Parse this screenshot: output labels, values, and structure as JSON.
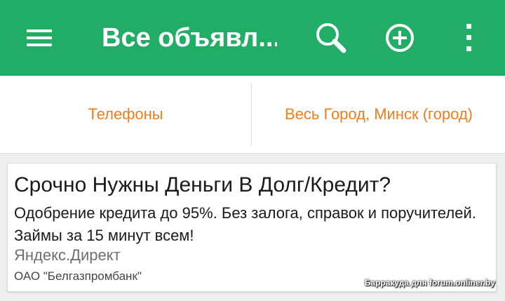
{
  "appbar": {
    "title": "Все объявл...",
    "menu_icon": "hamburger-menu-icon",
    "search_icon": "search-icon",
    "add_icon": "add-circle-icon",
    "more_icon": "more-vertical-icon",
    "background_color": "#22ad66"
  },
  "filters": {
    "category": "Телефоны",
    "location": "Весь Город, Минск (город)",
    "text_color": "#f07d1e"
  },
  "ad": {
    "title": "Срочно Нужны Деньги В Долг/Кредит?",
    "text": "Одобрение кредита до 95%. Без залога, справок и поручителей. Займы за 15 минут всем!",
    "source": "Яндекс.Директ",
    "advertiser": "ОАО \"Белгазпромбанк\""
  },
  "watermark": "Барракуда для forum.onliner.by"
}
